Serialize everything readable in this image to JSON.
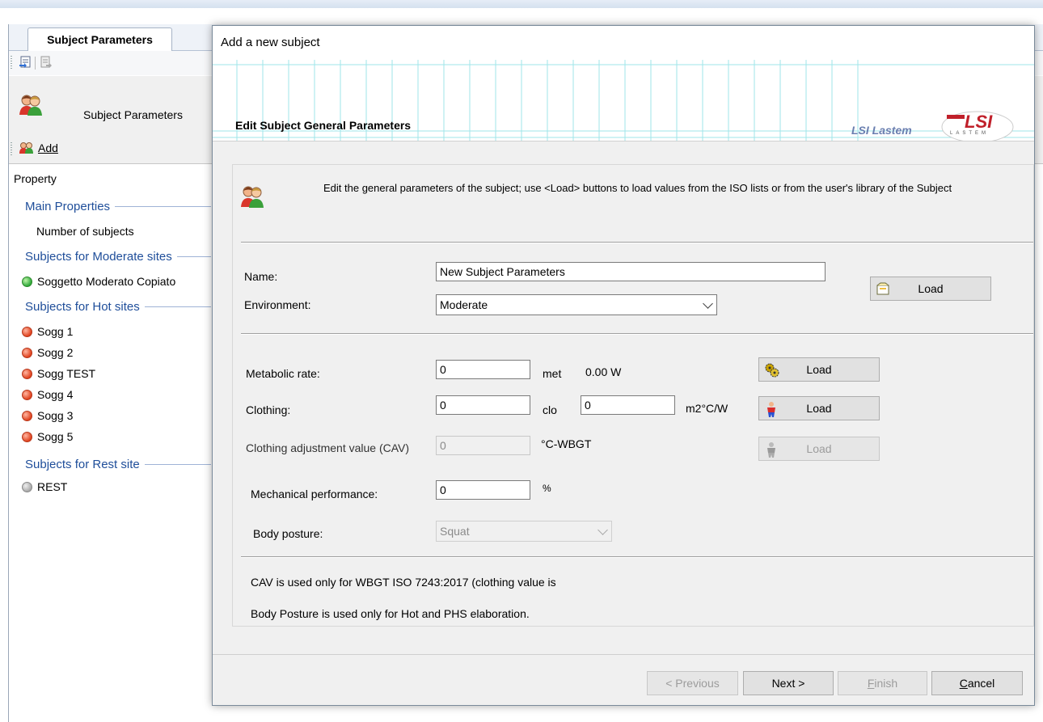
{
  "app": {
    "tab": "Subject Parameters",
    "header_title": "Subject Parameters",
    "add_label": "Add",
    "property_heading": "Property",
    "groups": {
      "main": "Main Properties",
      "moderate": "Subjects for Moderate sites",
      "hot": "Subjects for Hot sites",
      "rest": "Subjects for Rest site"
    },
    "number_of_subjects": "Number of subjects",
    "moderate_items": [
      "Soggetto Moderato Copiato"
    ],
    "hot_items": [
      "Sogg 1",
      "Sogg 2",
      "Sogg TEST",
      "Sogg 4",
      "Sogg 3",
      "Sogg 5"
    ],
    "rest_items": [
      "REST"
    ]
  },
  "dialog": {
    "title": "Add a new subject",
    "banner_title": "Edit Subject General Parameters",
    "brand_text": "LSI Lastem",
    "intro": "Edit the general parameters of the subject; use <Load> buttons to load values from the ISO lists or from the user's library of the Subject",
    "name_label": "Name:",
    "name_value": "New Subject Parameters",
    "environment_label": "Environment:",
    "environment_value": "Moderate",
    "load_label": "Load",
    "metabolic_label": "Metabolic rate:",
    "metabolic_value": "0",
    "metabolic_unit": "met",
    "metabolic_watts": "0.00 W",
    "clothing_label": "Clothing:",
    "clothing_value": "0",
    "clothing_unit": "clo",
    "clothing_m2_value": "0",
    "clothing_m2_unit": "m2°C/W",
    "cav_label": "Clothing adjustment value (CAV)",
    "cav_value": "0",
    "cav_unit": "°C-WBGT",
    "mech_label": "Mechanical performance:",
    "mech_value": "0",
    "mech_unit": "%",
    "posture_label": "Body posture:",
    "posture_value": "Squat",
    "note_cav": "CAV is used only for WBGT ISO 7243:2017 (clothing value is",
    "note_posture": "Body Posture is used only for Hot and PHS elaboration.",
    "btn_previous": "< Previous",
    "btn_next": "Next >",
    "btn_finish_u": "F",
    "btn_finish_rest": "inish",
    "btn_cancel_u": "C",
    "btn_cancel_rest": "ancel"
  }
}
